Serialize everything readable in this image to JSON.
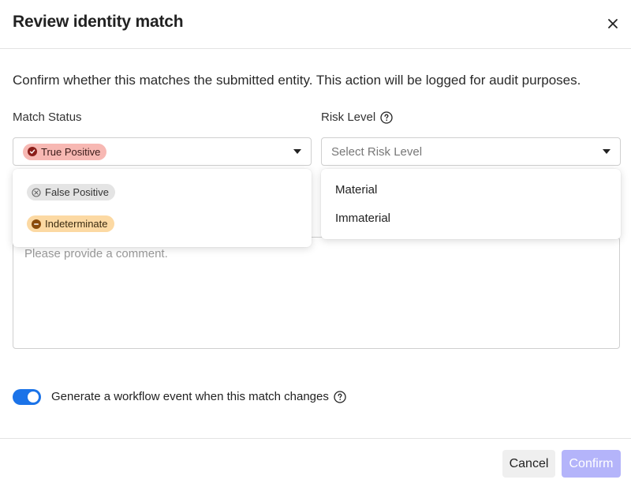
{
  "dialog": {
    "title": "Review identity match",
    "close_icon": "close-icon",
    "description": "Confirm whether this matches the submitted entity. This action will be logged for audit purposes."
  },
  "match_status": {
    "label": "Match Status",
    "selected": "True Positive",
    "selected_color": "#f7b8b3",
    "options": [
      {
        "label": "False Positive",
        "icon": "x-circle-icon",
        "color": "#e4e4e4"
      },
      {
        "label": "Indeterminate",
        "icon": "minus-circle-icon",
        "color": "#fcd9a3"
      }
    ]
  },
  "risk_level": {
    "label": "Risk Level",
    "help_icon": "question-circle-icon",
    "placeholder": "Select Risk Level",
    "options": [
      "Material",
      "Immaterial"
    ]
  },
  "comment": {
    "placeholder": "Please provide a comment."
  },
  "workflow_toggle": {
    "label": "Generate a workflow event when this match changes",
    "on": true,
    "color": "#1b73e8"
  },
  "footer": {
    "cancel_label": "Cancel",
    "confirm_label": "Confirm",
    "confirm_color": "#b4b4fa"
  }
}
